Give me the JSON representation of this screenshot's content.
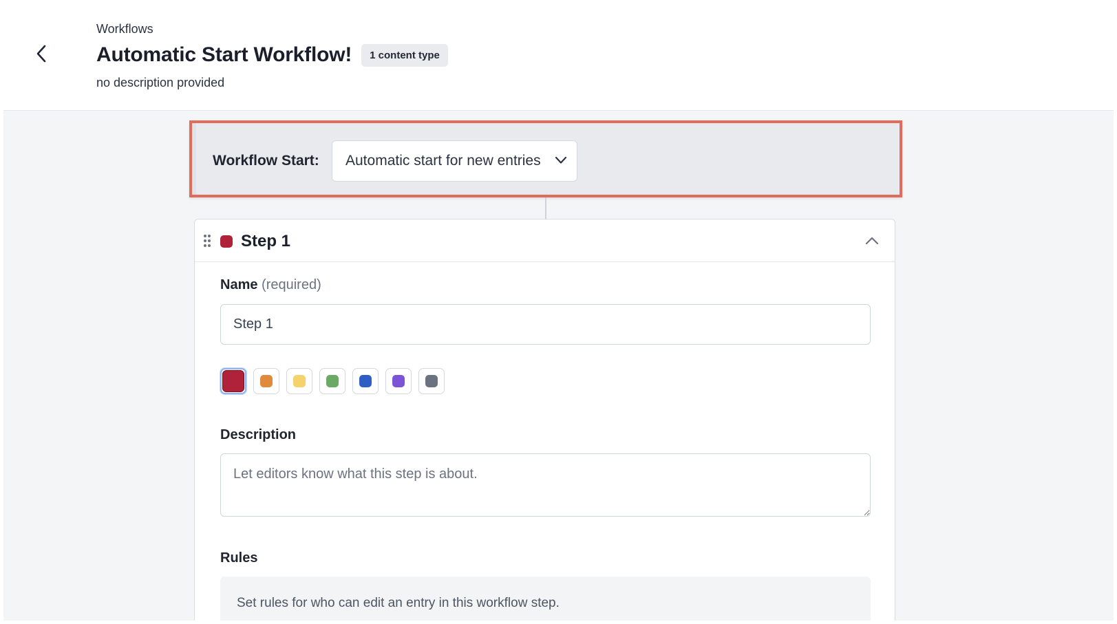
{
  "header": {
    "breadcrumb": "Workflows",
    "title": "Automatic Start Workflow!",
    "badge": "1 content type",
    "description": "no description provided",
    "back_icon": "chevron-left-icon"
  },
  "workflow_start": {
    "label": "Workflow Start:",
    "selected": "Automatic start for new entries",
    "icon": "chevron-down-icon",
    "highlight_color": "#e26b5b"
  },
  "step": {
    "title": "Step 1",
    "color": "#b0213a",
    "name_label": "Name",
    "name_required": "(required)",
    "name_value": "Step 1",
    "colors": [
      {
        "name": "red",
        "hex": "#b0213a",
        "selected": true
      },
      {
        "name": "orange",
        "hex": "#e08a3c",
        "selected": false
      },
      {
        "name": "yellow",
        "hex": "#f5d26b",
        "selected": false
      },
      {
        "name": "green",
        "hex": "#6aaa64",
        "selected": false
      },
      {
        "name": "blue",
        "hex": "#2f5fc4",
        "selected": false
      },
      {
        "name": "purple",
        "hex": "#7b55d6",
        "selected": false
      },
      {
        "name": "gray",
        "hex": "#6b7280",
        "selected": false
      }
    ],
    "description_label": "Description",
    "description_placeholder": "Let editors know what this step is about.",
    "rules_label": "Rules",
    "rules_text": "Set rules for who can edit an entry in this workflow step."
  }
}
